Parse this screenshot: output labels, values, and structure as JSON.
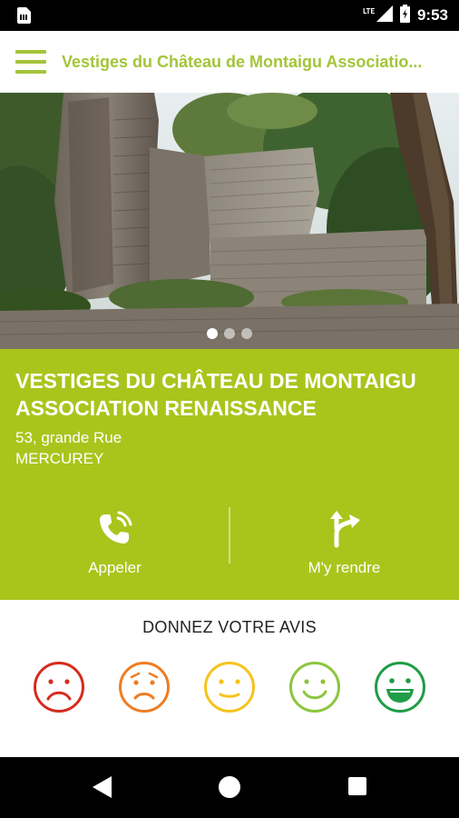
{
  "status_bar": {
    "time": "9:53",
    "network": "LTE",
    "icons": [
      "sim-card-icon",
      "signal-icon",
      "battery-charging-icon"
    ]
  },
  "app_bar": {
    "menu_icon": "hamburger-menu-icon",
    "title": "Vestiges du Château de Montaigu Associatio..."
  },
  "carousel": {
    "page_count": 3,
    "active_index": 0
  },
  "place": {
    "name": "VESTIGES DU CHÂTEAU DE MONTAIGU ASSOCIATION RENAISSANCE",
    "address_line1": "53, grande Rue",
    "address_line2": "MERCUREY"
  },
  "actions": {
    "call": {
      "label": "Appeler",
      "icon": "phone-ringing-icon"
    },
    "directions": {
      "label": "M'y rendre",
      "icon": "directions-arrow-icon"
    }
  },
  "review": {
    "title": "DONNEZ VOTRE AVIS",
    "ratings": [
      {
        "name": "very-sad",
        "color": "#d52b1e"
      },
      {
        "name": "sad",
        "color": "#ee7d23"
      },
      {
        "name": "neutral",
        "color": "#f5c31c"
      },
      {
        "name": "happy",
        "color": "#8cc63e"
      },
      {
        "name": "very-happy",
        "color": "#1f9d47"
      }
    ]
  },
  "colors": {
    "accent": "#a5c43a",
    "panel": "#a9c51c"
  },
  "nav_bar": {
    "icons": [
      "back-icon",
      "home-icon",
      "recents-icon"
    ]
  }
}
